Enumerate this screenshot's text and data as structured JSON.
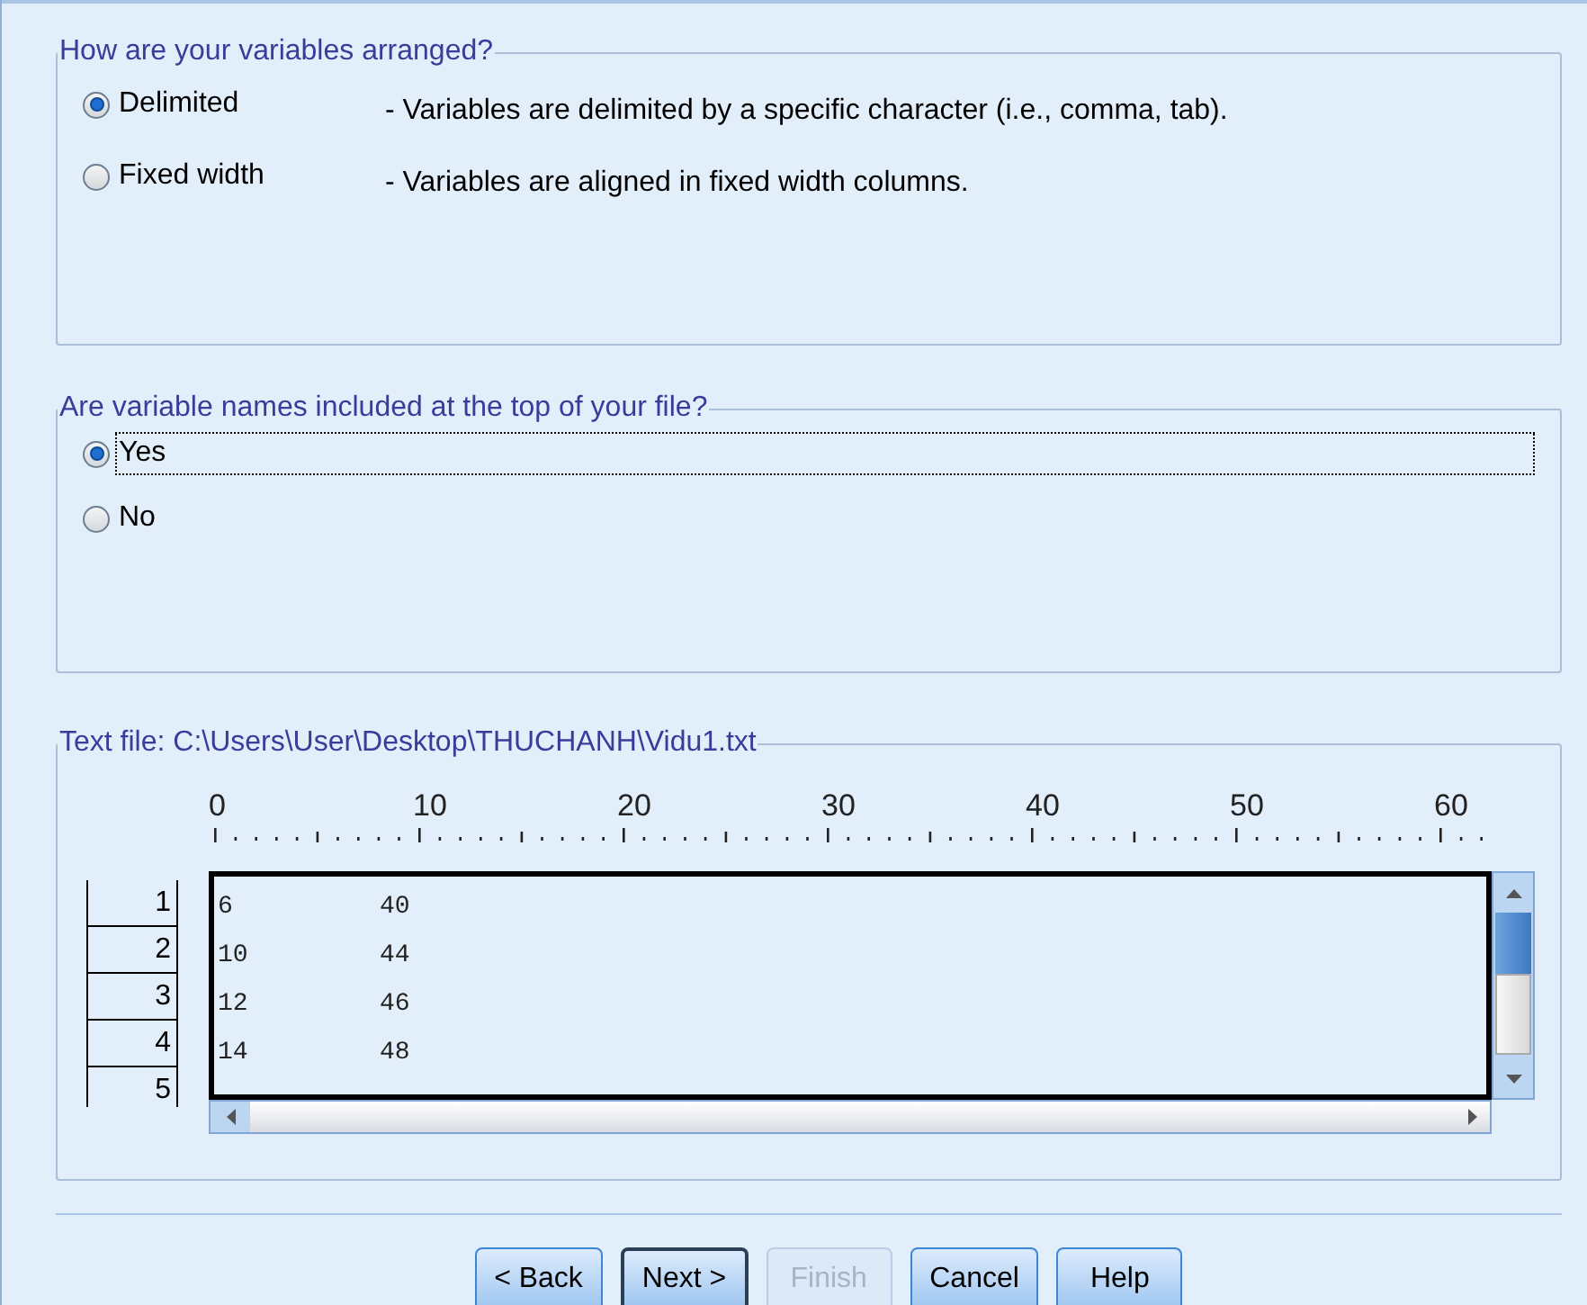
{
  "groups": [
    {
      "title": "How are your variables arranged?",
      "options": [
        {
          "label": "Delimited",
          "description": "- Variables are delimited by a specific character (i.e., comma, tab).",
          "selected": true,
          "focused": false
        },
        {
          "label": "Fixed width",
          "description": "- Variables are aligned in fixed width columns.",
          "selected": false,
          "focused": false
        }
      ]
    },
    {
      "title": "Are variable names included at the top of your file?",
      "options": [
        {
          "label": "Yes",
          "selected": true,
          "focused": true
        },
        {
          "label": "No",
          "selected": false,
          "focused": false
        }
      ]
    }
  ],
  "preview": {
    "title": "Text file:  C:\\Users\\User\\Desktop\\THUCHANH\\Vidu1.txt",
    "ruler": [
      "0",
      "10",
      "20",
      "30",
      "40",
      "50",
      "60"
    ],
    "rows": [
      {
        "number": "1",
        "cells": [
          "6",
          "40"
        ]
      },
      {
        "number": "2",
        "cells": [
          "10",
          "44"
        ]
      },
      {
        "number": "3",
        "cells": [
          "12",
          "46"
        ]
      },
      {
        "number": "4",
        "cells": [
          "14",
          "48"
        ]
      },
      {
        "number": "5"
      }
    ]
  },
  "buttons": [
    {
      "label": "< Back",
      "disabled": false,
      "default": false
    },
    {
      "label": "Next >",
      "disabled": false,
      "default": true
    },
    {
      "label": "Finish",
      "disabled": true,
      "default": false
    },
    {
      "label": "Cancel",
      "disabled": false,
      "default": false
    },
    {
      "label": "Help",
      "disabled": false,
      "default": false
    }
  ]
}
